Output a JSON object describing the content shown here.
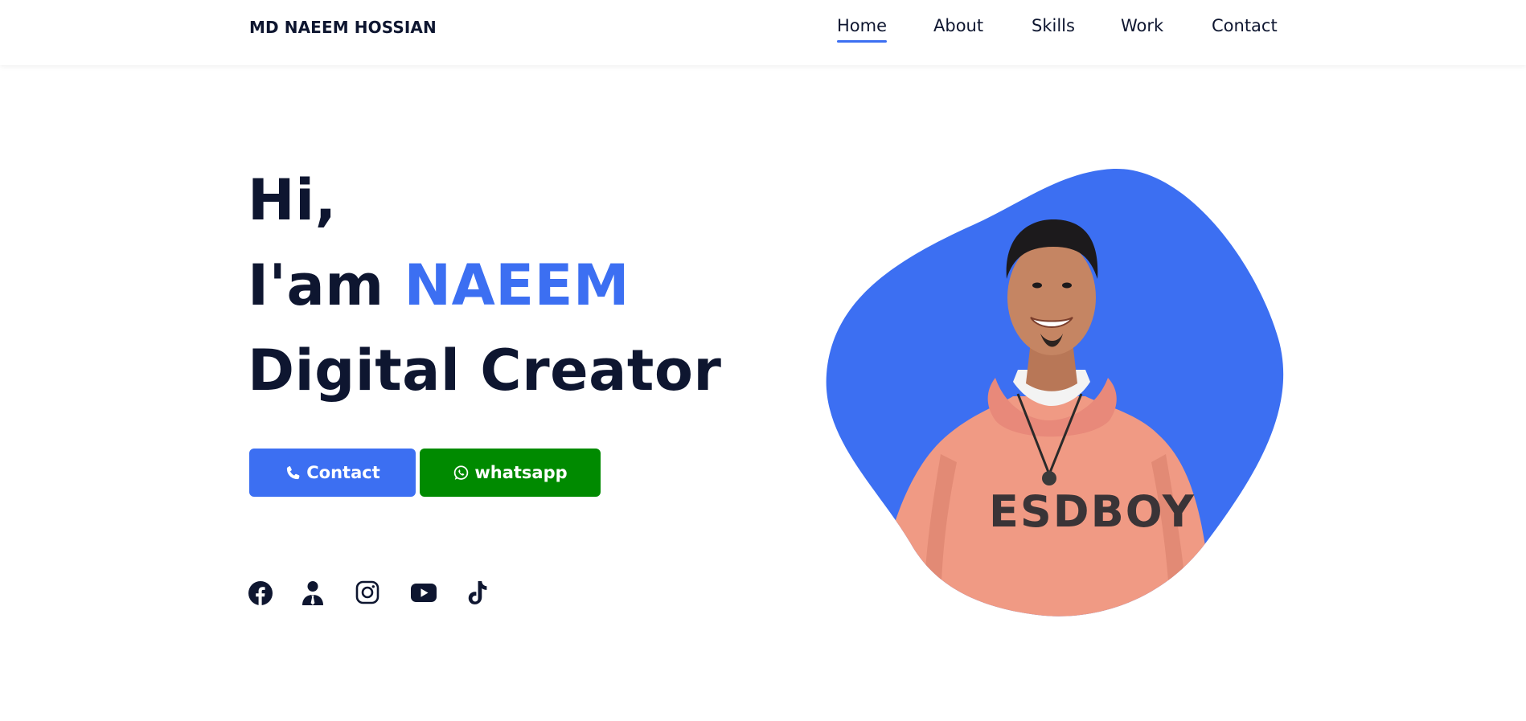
{
  "header": {
    "logo": "MD NAEEM HOSSIAN",
    "nav": [
      {
        "label": "Home",
        "active": true
      },
      {
        "label": "About",
        "active": false
      },
      {
        "label": "Skills",
        "active": false
      },
      {
        "label": "Work",
        "active": false
      },
      {
        "label": "Contact",
        "active": false
      }
    ]
  },
  "hero": {
    "greeting": "Hi,",
    "intro_prefix": "I'am ",
    "name": "NAEEM",
    "role": "Digital Creator",
    "buttons": {
      "contact_label": "Contact",
      "whatsapp_label": "whatsapp"
    },
    "social_icons": [
      "facebook-icon",
      "user-icon",
      "instagram-icon",
      "youtube-icon",
      "tiktok-icon"
    ],
    "image_subject": "portrait-photo"
  },
  "colors": {
    "accent": "#3c6ff2",
    "text": "#0e1630",
    "whatsapp": "#008a00",
    "background": "#ffffff"
  }
}
